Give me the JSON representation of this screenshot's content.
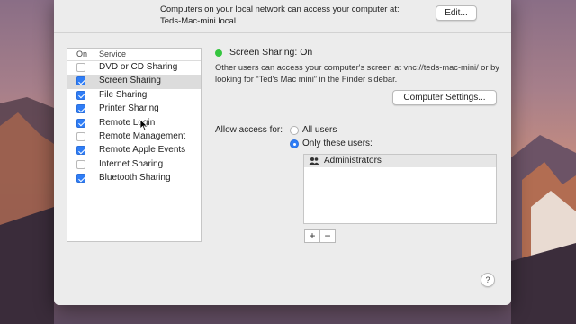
{
  "top_message": {
    "line1": "Computers on your local network can access your computer at:",
    "line2": "Teds-Mac-mini.local"
  },
  "edit_button_label": "Edit...",
  "services": {
    "header_on": "On",
    "header_service": "Service",
    "items": [
      {
        "label": "DVD or CD Sharing",
        "checked": false,
        "selected": false
      },
      {
        "label": "Screen Sharing",
        "checked": true,
        "selected": true
      },
      {
        "label": "File Sharing",
        "checked": true,
        "selected": false
      },
      {
        "label": "Printer Sharing",
        "checked": true,
        "selected": false
      },
      {
        "label": "Remote Login",
        "checked": true,
        "selected": false
      },
      {
        "label": "Remote Management",
        "checked": false,
        "selected": false
      },
      {
        "label": "Remote Apple Events",
        "checked": true,
        "selected": false
      },
      {
        "label": "Internet Sharing",
        "checked": false,
        "selected": false
      },
      {
        "label": "Bluetooth Sharing",
        "checked": true,
        "selected": false
      }
    ]
  },
  "status": {
    "title": "Screen Sharing: On",
    "description": "Other users can access your computer's screen at vnc://teds-mac-mini/ or by looking for “Ted's Mac mini” in the Finder sidebar.",
    "color": "#35c53f"
  },
  "computer_settings_label": "Computer Settings...",
  "access": {
    "label": "Allow access for:",
    "option_all": "All users",
    "option_only": "Only these users:",
    "selected": "only"
  },
  "users": [
    "Administrators"
  ],
  "add_label": "+",
  "remove_label": "−",
  "help_label": "?",
  "accent_color": "#2f7df6"
}
